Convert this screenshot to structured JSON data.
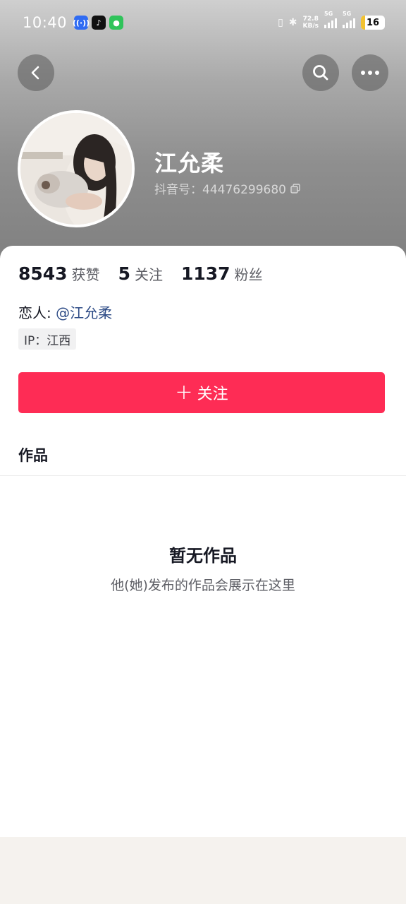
{
  "status_bar": {
    "time": "10:40",
    "net_speed_value": "72.8",
    "net_speed_unit": "KB/s",
    "sig1_label": "5G",
    "sig2_label": "5G",
    "battery_level": "16"
  },
  "profile": {
    "name": "江允柔",
    "douyin_id": "抖音号：44476299680"
  },
  "stats": {
    "likes_value": "8543",
    "likes_label": "获赞",
    "following_value": "5",
    "following_label": "关注",
    "followers_value": "1137",
    "followers_label": "粉丝"
  },
  "relation": {
    "label": "恋人:",
    "link": "@江允柔"
  },
  "ip": "IP：江西",
  "follow_button": {
    "plus": "+",
    "label": "关注"
  },
  "tabs": {
    "works": "作品"
  },
  "empty_state": {
    "title": "暂无作品",
    "description": "他(她)发布的作品会展示在这里"
  },
  "colors": {
    "accent": "#fe2c55",
    "link": "#2d4b86"
  },
  "icons": {
    "back": "chevron-left-icon",
    "search": "search-icon",
    "more": "more-dots-icon",
    "copy": "copy-icon"
  }
}
